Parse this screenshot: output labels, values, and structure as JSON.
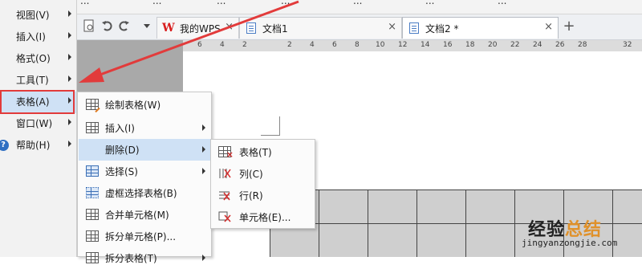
{
  "top_toolbar": {
    "items": [
      "...",
      "...",
      "...",
      "...",
      "...",
      "...",
      "..."
    ]
  },
  "tabs": [
    {
      "label": "我的WPS",
      "close": "×"
    },
    {
      "label": "文档1",
      "close": "×"
    },
    {
      "label": "文档2 *",
      "close": "×"
    }
  ],
  "new_tab": "+",
  "ruler": {
    "numbers": [
      "6",
      "4",
      "2",
      "",
      "2",
      "4",
      "6",
      "8",
      "10",
      "12",
      "14",
      "16",
      "18",
      "20",
      "22",
      "24",
      "26",
      "28",
      "",
      "32"
    ]
  },
  "main_menu": {
    "items": [
      {
        "label": "视图(V)"
      },
      {
        "label": "插入(I)"
      },
      {
        "label": "格式(O)"
      },
      {
        "label": "工具(T)"
      },
      {
        "label": "表格(A)"
      },
      {
        "label": "窗口(W)"
      },
      {
        "label": "帮助(H)"
      }
    ],
    "help_glyph": "?"
  },
  "table_menu": {
    "items": [
      {
        "label": "绘制表格(W)",
        "icon": "draw-table-icon"
      },
      {
        "label": "插入(I)",
        "icon": "insert-table-icon"
      },
      {
        "label": "删除(D)",
        "icon": "delete-icon"
      },
      {
        "label": "选择(S)",
        "icon": "select-table-icon"
      },
      {
        "label": "虚框选择表格(B)",
        "icon": "dotted-select-table-icon"
      },
      {
        "label": "合并单元格(M)",
        "icon": "merge-cells-icon"
      },
      {
        "label": "拆分单元格(P)...",
        "icon": "split-cells-icon"
      },
      {
        "label": "拆分表格(T)",
        "icon": "split-table-icon"
      }
    ]
  },
  "delete_menu": {
    "items": [
      {
        "label": "表格(T)",
        "icon": "delete-table-icon"
      },
      {
        "label": "列(C)",
        "icon": "delete-column-icon"
      },
      {
        "label": "行(R)",
        "icon": "delete-row-icon"
      },
      {
        "label": "单元格(E)...",
        "icon": "delete-cell-icon"
      }
    ]
  },
  "watermark": {
    "title_part1": "经验",
    "title_part2": "总结",
    "url": "jingyanzongjie.com"
  },
  "colors": {
    "highlight": "#cfe1f5",
    "annotation_red": "#e23b3b",
    "wps_red": "#d81e1e"
  }
}
